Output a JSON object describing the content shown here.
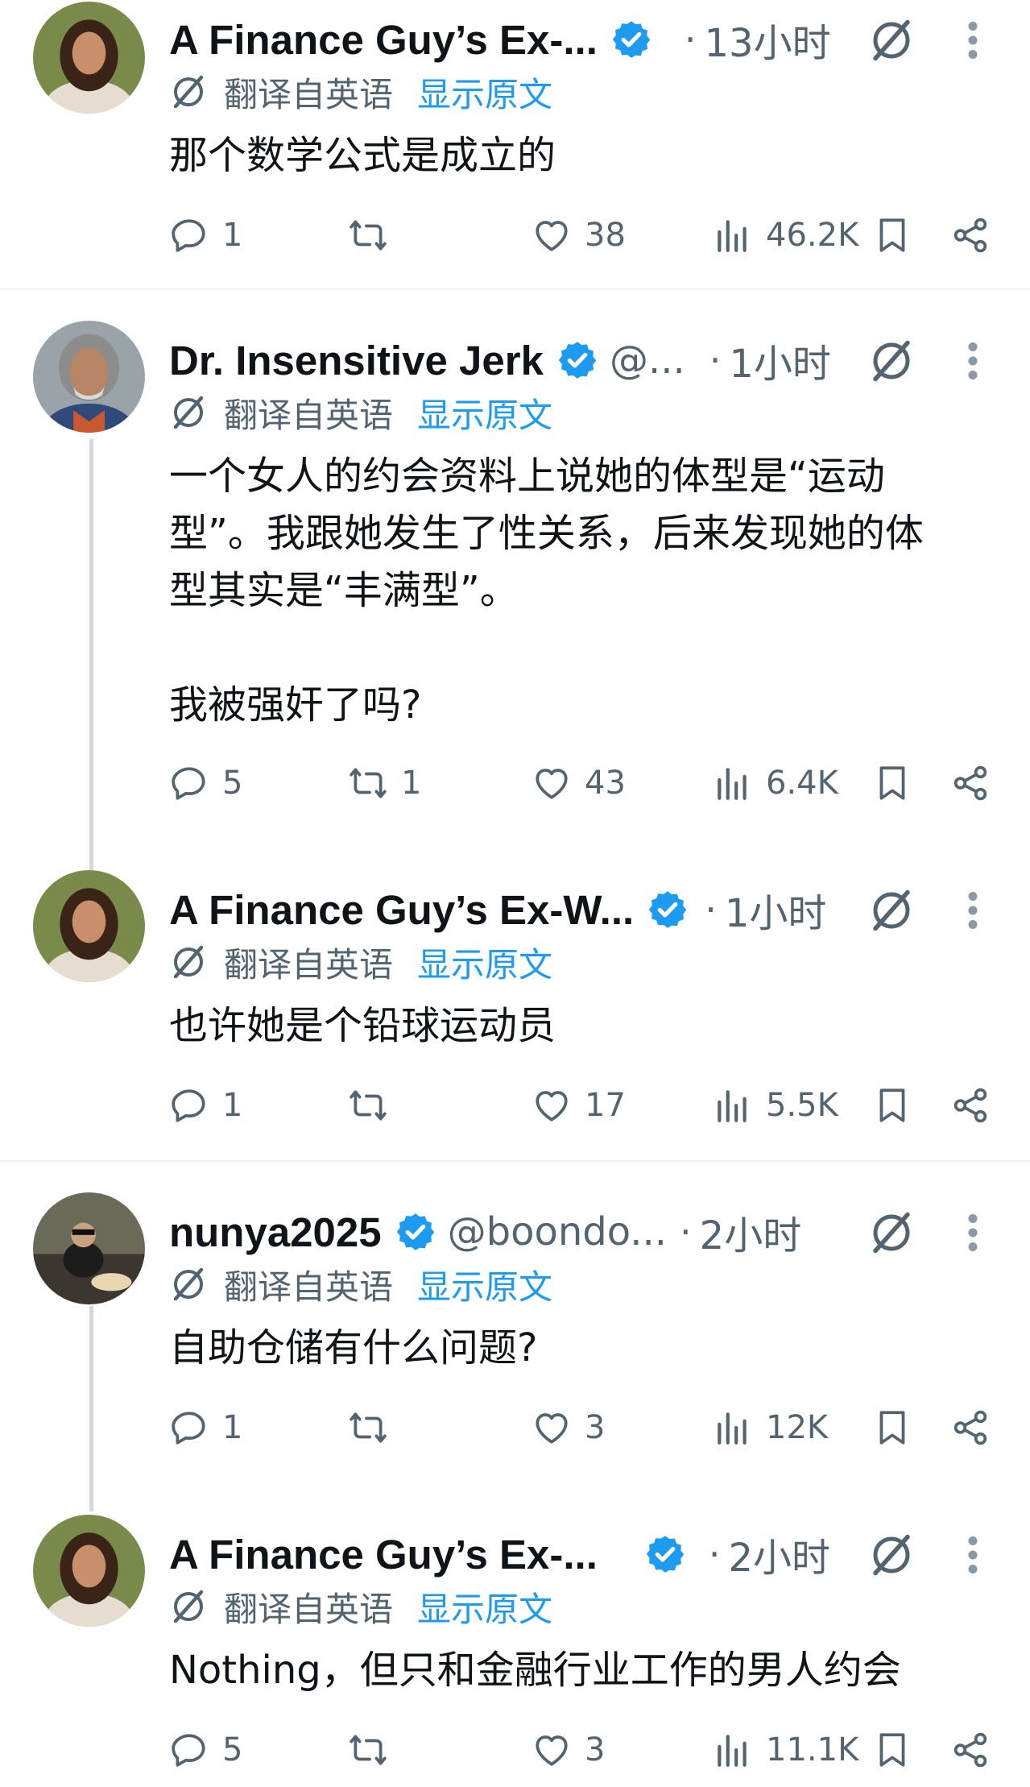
{
  "translate": {
    "label": "翻译自英语",
    "link": "显示原文"
  },
  "tweets": [
    {
      "name": "A Finance Guy’s Ex-...",
      "handle": "",
      "time": "13小时",
      "text": "那个数学公式是成立的",
      "replies": "1",
      "reposts": "",
      "likes": "38",
      "views": "46.2K",
      "avatar": "woman"
    },
    {
      "name": "Dr. Insensitive Jerk",
      "handle": "@...",
      "time": "1小时",
      "text": "一个女人的约会资料上说她的体型是“运动\n型”。我跟她发生了性关系，后来发现她的体\n型其实是“丰满型”。\n\n我被强奸了吗?",
      "replies": "5",
      "reposts": "1",
      "likes": "43",
      "views": "6.4K",
      "avatar": "man"
    },
    {
      "name": "A Finance Guy’s Ex-W...",
      "handle": "",
      "time": "1小时",
      "text": "也许她是个铅球运动员",
      "replies": "1",
      "reposts": "",
      "likes": "17",
      "views": "5.5K",
      "avatar": "woman"
    },
    {
      "name": "nunya2025",
      "handle": "@boondo...",
      "time": "2小时",
      "text": "自助仓储有什么问题?",
      "replies": "1",
      "reposts": "",
      "likes": "3",
      "views": "12K",
      "avatar": "photo"
    },
    {
      "name": "A Finance Guy’s Ex-...",
      "handle": "",
      "time": "2小时",
      "text": "Nothing，但只和金融行业工作的男人约会",
      "replies": "5",
      "reposts": "",
      "likes": "3",
      "views": "11.1K",
      "avatar": "woman"
    }
  ],
  "colors": {
    "accent": "#1d9bf0",
    "muted": "#536471",
    "text": "#0f1419",
    "divider": "#eff3f4",
    "thread": "#cfd9de"
  }
}
